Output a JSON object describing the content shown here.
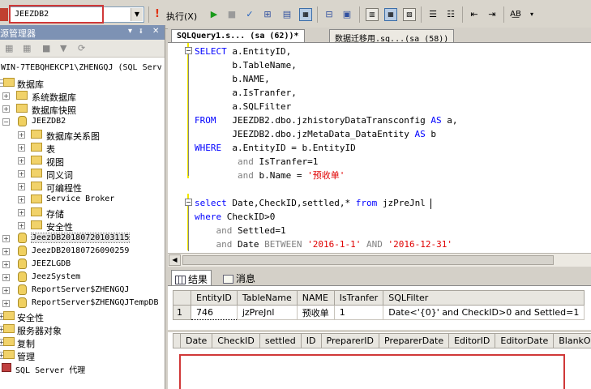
{
  "toolbar": {
    "database": "JEEZDB2",
    "execute_label": "执行(X)"
  },
  "object_explorer": {
    "title": "源管理器",
    "pin": "▾ ᵻ X",
    "server": "WIN-7TEBQHEKCP1\\ZHENGQJ (SQL Serv",
    "nodes": [
      {
        "label": "数据库"
      },
      {
        "label": "系统数据库"
      },
      {
        "label": "数据库快照"
      },
      {
        "label": "JEEZDB2"
      },
      {
        "label": "数据库关系图"
      },
      {
        "label": "表"
      },
      {
        "label": "视图"
      },
      {
        "label": "同义词"
      },
      {
        "label": "可编程性"
      },
      {
        "label": "Service Broker"
      },
      {
        "label": "存储"
      },
      {
        "label": "安全性"
      },
      {
        "label": "JeezDB20180720103115"
      },
      {
        "label": "JeezDB20180726090259"
      },
      {
        "label": "JEEZLGDB"
      },
      {
        "label": "JeezSystem"
      },
      {
        "label": "ReportServer$ZHENGQJ"
      },
      {
        "label": "ReportServer$ZHENGQJTempDB"
      },
      {
        "label": "安全性"
      },
      {
        "label": "服务器对象"
      },
      {
        "label": "复制"
      },
      {
        "label": "管理"
      },
      {
        "label": "SQL Server 代理"
      }
    ]
  },
  "tabs": [
    {
      "label": "SQLQuery1.s... (sa (62))*"
    },
    {
      "label": "数据迁移用.sq...(sa (58))"
    }
  ],
  "code": {
    "l1_kw": "SELECT",
    "l1_rest": "a.EntityID,",
    "l2": "b.TableName,",
    "l3": "b.NAME,",
    "l4": "a.IsTranfer,",
    "l5": "a.SQLFilter",
    "l6_kw": "FROM",
    "l6_obj": "JEEZDB2.dbo.jzhistoryDataTransconfig",
    "l6_as": "AS",
    "l6_alias": "a,",
    "l7_obj": "JEEZDB2.dbo.jzMetaData_DataEntity",
    "l7_as": "AS",
    "l7_alias": "b",
    "l8_kw": "WHERE",
    "l8_rest": "a.EntityID = b.EntityID",
    "l9_and": "and",
    "l9_rest": "IsTranfer=1",
    "l10_and": "and",
    "l10_col": "b.Name =",
    "l10_str": "'预收单'",
    "l12_sel": "select",
    "l12_cols": "Date,CheckID,settled,*",
    "l12_from": "from",
    "l12_tbl": "jzPreJnl",
    "l13_kw": "where",
    "l13_rest": "CheckID>0",
    "l14_and": "and",
    "l14_rest": "Settled=1",
    "l15_and": "and",
    "l15_col": "Date",
    "l15_between": "BETWEEN",
    "l15_s1": "'2016-1-1'",
    "l15_and2": "AND",
    "l15_s2": "'2016-12-31'"
  },
  "result_tabs": {
    "results": "结果",
    "messages": "消息"
  },
  "grid1": {
    "headers": [
      "EntityID",
      "TableName",
      "NAME",
      "IsTranfer",
      "SQLFilter"
    ],
    "rows": [
      {
        "num": "1",
        "cells": [
          "746",
          "jzPreJnl",
          "预收单",
          "1",
          "Date<'{0}' and CheckID>0 and Settled=1"
        ]
      }
    ]
  },
  "grid2": {
    "headers": [
      "Date",
      "CheckID",
      "settled",
      "ID",
      "PreparerID",
      "PreparerDate",
      "EditorID",
      "EditorDate",
      "BlankOut"
    ]
  }
}
